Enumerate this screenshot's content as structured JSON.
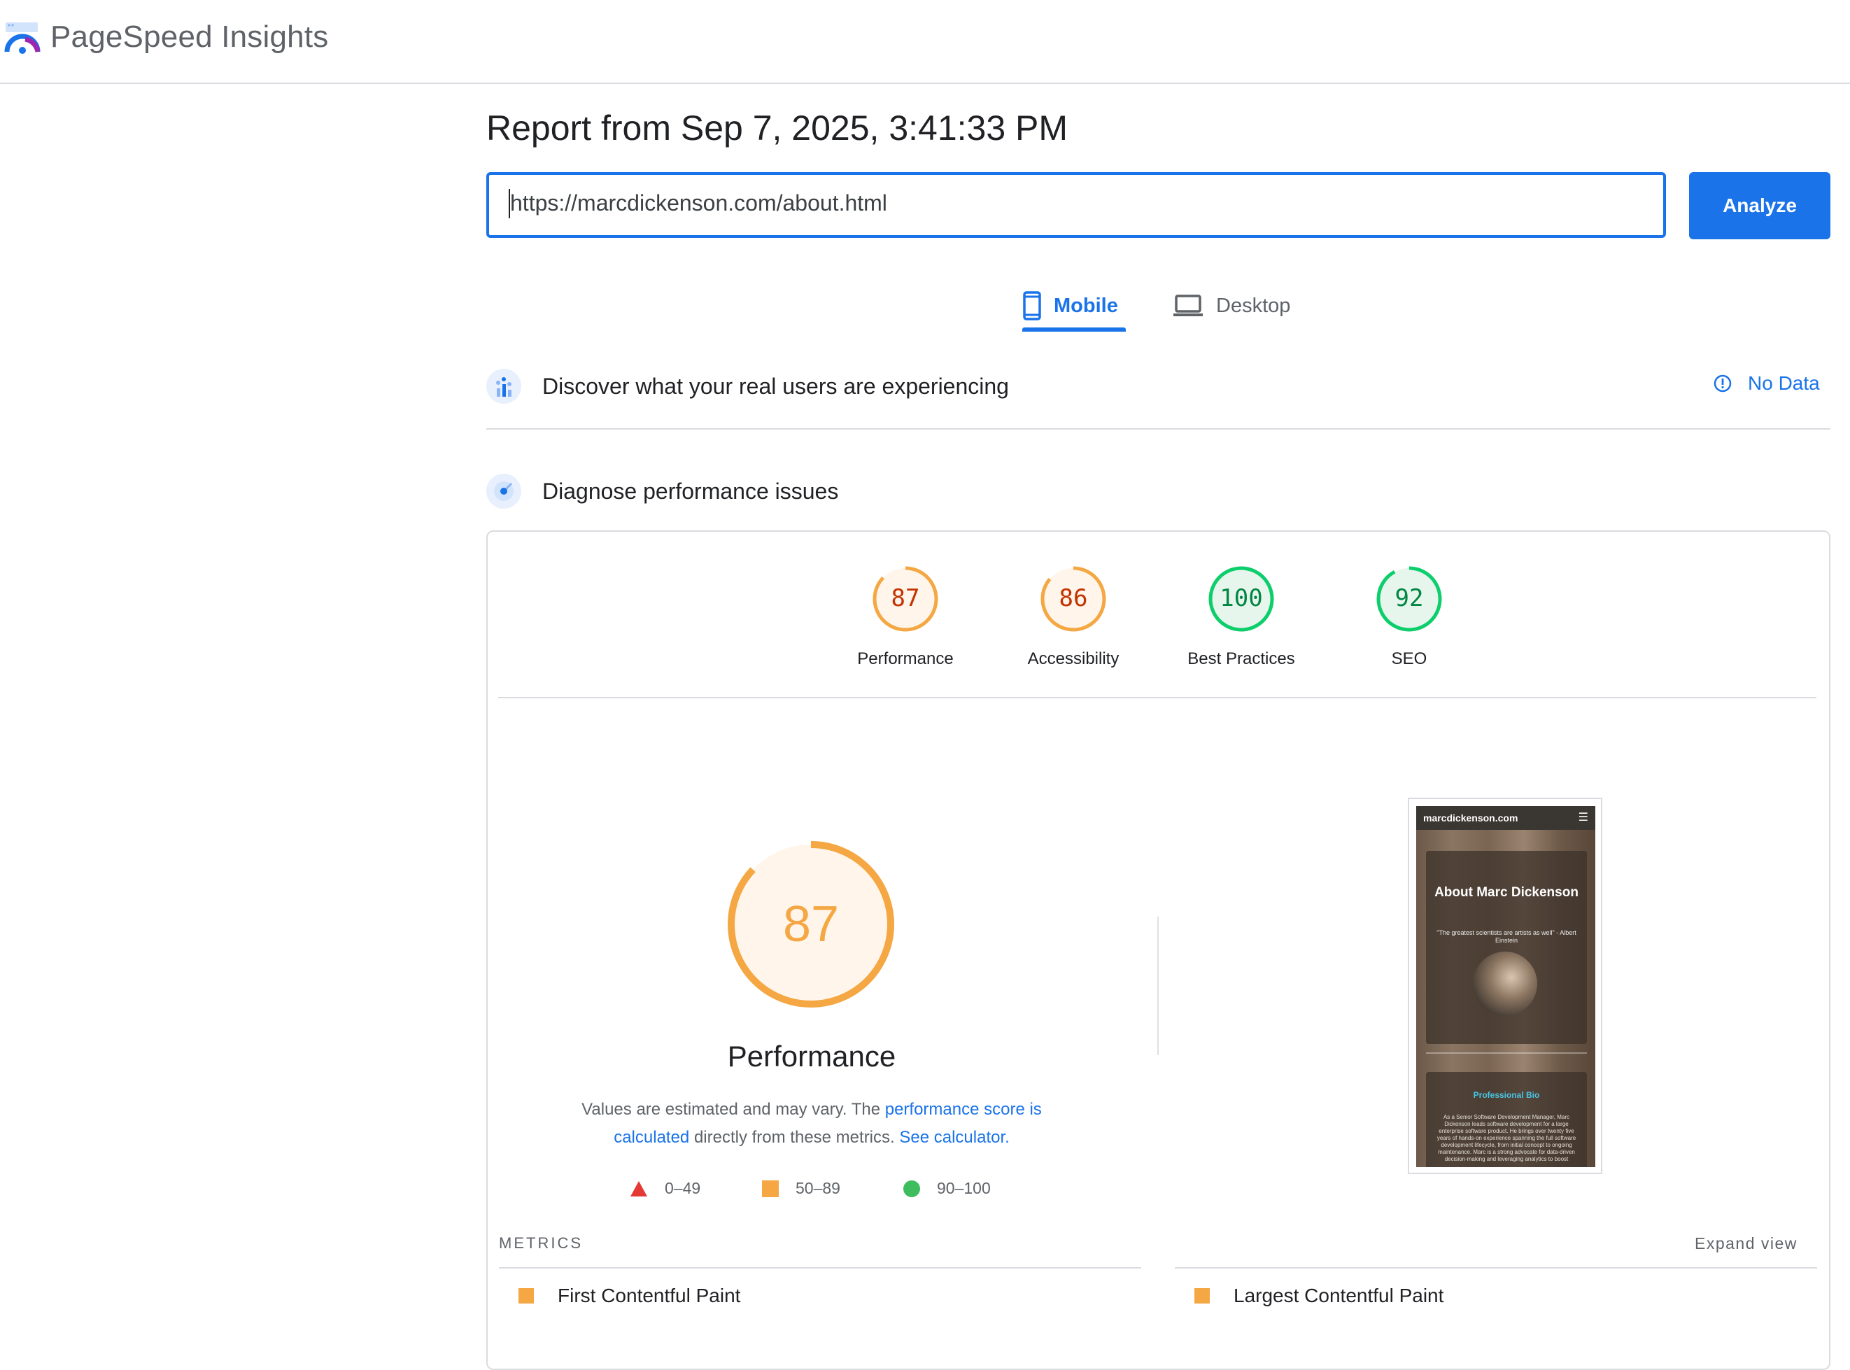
{
  "app": {
    "title": "PageSpeed Insights"
  },
  "report": {
    "title": "Report from Sep 7, 2025, 3:41:33 PM"
  },
  "search": {
    "url": "https://marcdickenson.com/about.html",
    "analyze_label": "Analyze"
  },
  "tabs": [
    {
      "label": "Mobile",
      "icon": "smartphone-icon",
      "active": true
    },
    {
      "label": "Desktop",
      "icon": "laptop-icon",
      "active": false
    }
  ],
  "field_data": {
    "title": "Discover what your real users are experiencing",
    "status": "No Data",
    "icon": "users-chart-icon"
  },
  "lab": {
    "title": "Diagnose performance issues",
    "icon": "radar-icon"
  },
  "scores": [
    {
      "label": "Performance",
      "value": "87",
      "score": 87,
      "color": "#f4a742",
      "text_color": "#c33300"
    },
    {
      "label": "Accessibility",
      "value": "86",
      "score": 86,
      "color": "#f4a742",
      "text_color": "#c33300"
    },
    {
      "label": "Best Practices",
      "value": "100",
      "score": 100,
      "color": "#0cce6b",
      "text_color": "#018642"
    },
    {
      "label": "SEO",
      "value": "92",
      "score": 92,
      "color": "#0cce6b",
      "text_color": "#018642"
    }
  ],
  "performance": {
    "value": "87",
    "score": 87,
    "title": "Performance",
    "desc_pre": "Values are estimated and may vary. The ",
    "desc_link1": "performance score is calculated",
    "desc_mid": " directly from these metrics. ",
    "desc_link2": "See calculator."
  },
  "legend": [
    {
      "range": "0–49",
      "shape": "triangle",
      "color": "#e53935"
    },
    {
      "range": "50–89",
      "shape": "square",
      "color": "#f4a742"
    },
    {
      "range": "90–100",
      "shape": "circle",
      "color": "#3dbd5d"
    }
  ],
  "metrics": {
    "heading": "METRICS",
    "expand_label": "Expand view",
    "items": [
      {
        "label": "First Contentful Paint",
        "color": "#f4a742"
      },
      {
        "label": "Largest Contentful Paint",
        "color": "#f4a742"
      }
    ]
  },
  "screenshot": {
    "site": "marcdickenson.com",
    "heading": "About Marc Dickenson",
    "quote": "\"The greatest scientists are artists as well\" - Albert Einstein",
    "bio_heading": "Professional Bio",
    "bio_text": "As a Senior Software Development Manager, Marc Dickenson leads software development for a large enterprise software product. He brings over twenty five years of hands-on experience spanning the full software development lifecycle, from initial concept to ongoing maintenance. Marc is a strong advocate for data-driven decision-making and leveraging analytics to boost"
  }
}
